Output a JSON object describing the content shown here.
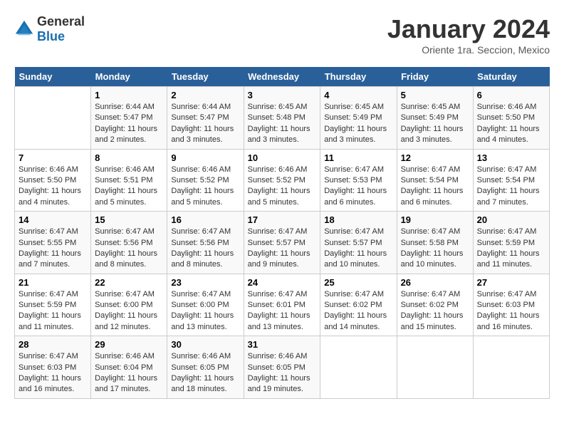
{
  "header": {
    "logo_general": "General",
    "logo_blue": "Blue",
    "month_title": "January 2024",
    "location": "Oriente 1ra. Seccion, Mexico"
  },
  "calendar": {
    "days_of_week": [
      "Sunday",
      "Monday",
      "Tuesday",
      "Wednesday",
      "Thursday",
      "Friday",
      "Saturday"
    ],
    "weeks": [
      [
        {
          "day": "",
          "info": ""
        },
        {
          "day": "1",
          "info": "Sunrise: 6:44 AM\nSunset: 5:47 PM\nDaylight: 11 hours\nand 2 minutes."
        },
        {
          "day": "2",
          "info": "Sunrise: 6:44 AM\nSunset: 5:47 PM\nDaylight: 11 hours\nand 3 minutes."
        },
        {
          "day": "3",
          "info": "Sunrise: 6:45 AM\nSunset: 5:48 PM\nDaylight: 11 hours\nand 3 minutes."
        },
        {
          "day": "4",
          "info": "Sunrise: 6:45 AM\nSunset: 5:49 PM\nDaylight: 11 hours\nand 3 minutes."
        },
        {
          "day": "5",
          "info": "Sunrise: 6:45 AM\nSunset: 5:49 PM\nDaylight: 11 hours\nand 3 minutes."
        },
        {
          "day": "6",
          "info": "Sunrise: 6:46 AM\nSunset: 5:50 PM\nDaylight: 11 hours\nand 4 minutes."
        }
      ],
      [
        {
          "day": "7",
          "info": "Sunrise: 6:46 AM\nSunset: 5:50 PM\nDaylight: 11 hours\nand 4 minutes."
        },
        {
          "day": "8",
          "info": "Sunrise: 6:46 AM\nSunset: 5:51 PM\nDaylight: 11 hours\nand 5 minutes."
        },
        {
          "day": "9",
          "info": "Sunrise: 6:46 AM\nSunset: 5:52 PM\nDaylight: 11 hours\nand 5 minutes."
        },
        {
          "day": "10",
          "info": "Sunrise: 6:46 AM\nSunset: 5:52 PM\nDaylight: 11 hours\nand 5 minutes."
        },
        {
          "day": "11",
          "info": "Sunrise: 6:47 AM\nSunset: 5:53 PM\nDaylight: 11 hours\nand 6 minutes."
        },
        {
          "day": "12",
          "info": "Sunrise: 6:47 AM\nSunset: 5:54 PM\nDaylight: 11 hours\nand 6 minutes."
        },
        {
          "day": "13",
          "info": "Sunrise: 6:47 AM\nSunset: 5:54 PM\nDaylight: 11 hours\nand 7 minutes."
        }
      ],
      [
        {
          "day": "14",
          "info": "Sunrise: 6:47 AM\nSunset: 5:55 PM\nDaylight: 11 hours\nand 7 minutes."
        },
        {
          "day": "15",
          "info": "Sunrise: 6:47 AM\nSunset: 5:56 PM\nDaylight: 11 hours\nand 8 minutes."
        },
        {
          "day": "16",
          "info": "Sunrise: 6:47 AM\nSunset: 5:56 PM\nDaylight: 11 hours\nand 8 minutes."
        },
        {
          "day": "17",
          "info": "Sunrise: 6:47 AM\nSunset: 5:57 PM\nDaylight: 11 hours\nand 9 minutes."
        },
        {
          "day": "18",
          "info": "Sunrise: 6:47 AM\nSunset: 5:57 PM\nDaylight: 11 hours\nand 10 minutes."
        },
        {
          "day": "19",
          "info": "Sunrise: 6:47 AM\nSunset: 5:58 PM\nDaylight: 11 hours\nand 10 minutes."
        },
        {
          "day": "20",
          "info": "Sunrise: 6:47 AM\nSunset: 5:59 PM\nDaylight: 11 hours\nand 11 minutes."
        }
      ],
      [
        {
          "day": "21",
          "info": "Sunrise: 6:47 AM\nSunset: 5:59 PM\nDaylight: 11 hours\nand 11 minutes."
        },
        {
          "day": "22",
          "info": "Sunrise: 6:47 AM\nSunset: 6:00 PM\nDaylight: 11 hours\nand 12 minutes."
        },
        {
          "day": "23",
          "info": "Sunrise: 6:47 AM\nSunset: 6:00 PM\nDaylight: 11 hours\nand 13 minutes."
        },
        {
          "day": "24",
          "info": "Sunrise: 6:47 AM\nSunset: 6:01 PM\nDaylight: 11 hours\nand 13 minutes."
        },
        {
          "day": "25",
          "info": "Sunrise: 6:47 AM\nSunset: 6:02 PM\nDaylight: 11 hours\nand 14 minutes."
        },
        {
          "day": "26",
          "info": "Sunrise: 6:47 AM\nSunset: 6:02 PM\nDaylight: 11 hours\nand 15 minutes."
        },
        {
          "day": "27",
          "info": "Sunrise: 6:47 AM\nSunset: 6:03 PM\nDaylight: 11 hours\nand 16 minutes."
        }
      ],
      [
        {
          "day": "28",
          "info": "Sunrise: 6:47 AM\nSunset: 6:03 PM\nDaylight: 11 hours\nand 16 minutes."
        },
        {
          "day": "29",
          "info": "Sunrise: 6:46 AM\nSunset: 6:04 PM\nDaylight: 11 hours\nand 17 minutes."
        },
        {
          "day": "30",
          "info": "Sunrise: 6:46 AM\nSunset: 6:05 PM\nDaylight: 11 hours\nand 18 minutes."
        },
        {
          "day": "31",
          "info": "Sunrise: 6:46 AM\nSunset: 6:05 PM\nDaylight: 11 hours\nand 19 minutes."
        },
        {
          "day": "",
          "info": ""
        },
        {
          "day": "",
          "info": ""
        },
        {
          "day": "",
          "info": ""
        }
      ]
    ]
  }
}
